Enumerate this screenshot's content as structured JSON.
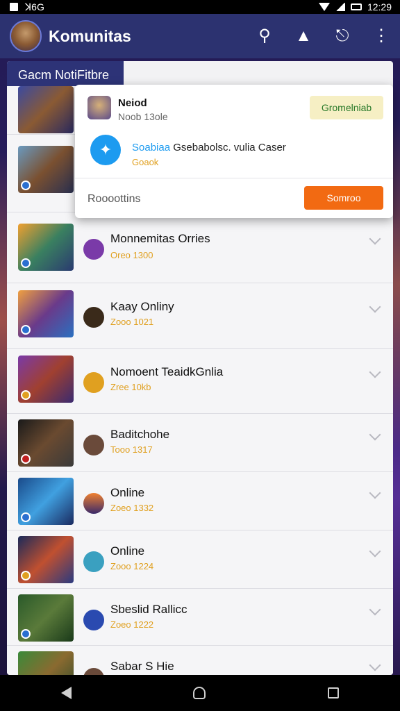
{
  "status_bar": {
    "left_text": "ꓘ6G",
    "time": "12:29"
  },
  "app_bar": {
    "title": "Komunitas",
    "icons": [
      "app-logo-icon",
      "search-icon",
      "notification-icon",
      "shield-icon",
      "overflow-menu-icon"
    ]
  },
  "section": {
    "title": "Gacm NotiFitbre"
  },
  "popup": {
    "name": "Neiod",
    "handle": "Noob 13ole",
    "tag": "Gromelniab",
    "message_accent": "Soabiaa",
    "message_rest": " Gsebabolsc. vulia Caser",
    "message_sub": "Goaok",
    "footer_text": "Roooottins",
    "button": "Somroo"
  },
  "list": [
    {
      "title": "Monnemitas Orries",
      "sub": "Oreo 1300"
    },
    {
      "title": "Kaay Onliny",
      "sub": "Zooo 1021"
    },
    {
      "title": "Nomoent TeaidkGnlia",
      "sub": "Zree 10kb"
    },
    {
      "title": "Baditchohe",
      "sub": "Tooo 1317"
    },
    {
      "title": "Online",
      "sub": "Zoeo 1332"
    },
    {
      "title": "Online",
      "sub": "Zooo 1224"
    },
    {
      "title": "Sbeslid Rallicc",
      "sub": "Zoeo 1222"
    },
    {
      "title": "Sabar S Hie",
      "sub": ""
    }
  ],
  "colors": {
    "app_bar": "#2c3270",
    "accent_orange": "#f26a12",
    "sub_text": "#e0a020",
    "twitter_blue": "#1d9bf0"
  }
}
